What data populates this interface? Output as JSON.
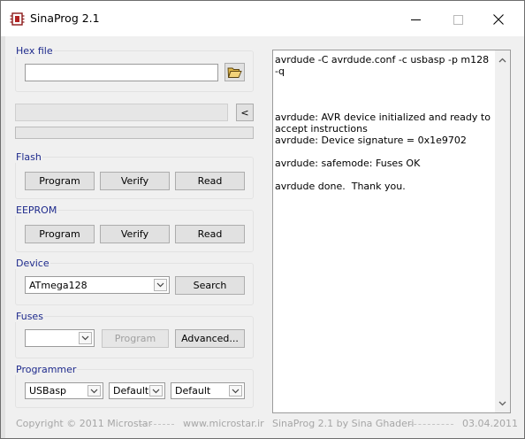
{
  "window": {
    "title": "SinaProg 2.1",
    "icon": "chip-icon"
  },
  "hex_file": {
    "legend": "Hex file",
    "path_value": "",
    "open_icon": "folder-open-icon"
  },
  "progress": {
    "collapse_label": "<",
    "value_percent": 0
  },
  "flash": {
    "legend": "Flash",
    "program_label": "Program",
    "verify_label": "Verify",
    "read_label": "Read"
  },
  "eeprom": {
    "legend": "EEPROM",
    "program_label": "Program",
    "verify_label": "Verify",
    "read_label": "Read"
  },
  "device": {
    "legend": "Device",
    "selected": "ATmega128",
    "search_label": "Search"
  },
  "fuses": {
    "legend": "Fuses",
    "selected": "",
    "program_label": "Program",
    "advanced_label": "Advanced..."
  },
  "programmer": {
    "legend": "Programmer",
    "type_selected": "USBasp",
    "port_selected": "Default",
    "speed_selected": "Default"
  },
  "console": {
    "text": "avrdude -C avrdude.conf -c usbasp -p m128 -q\n\n\n\navrdude: AVR device initialized and ready to accept instructions\navrdude: Device signature = 0x1e9702\n\navrdude: safemode: Fuses OK\n\navrdude done.  Thank you."
  },
  "status": {
    "copyright": "Copyright © 2011 Microstar",
    "website": "www.microstar.ir",
    "author": "SinaProg 2.1  by  Sina Ghaderi",
    "date": "03.04.2011"
  }
}
